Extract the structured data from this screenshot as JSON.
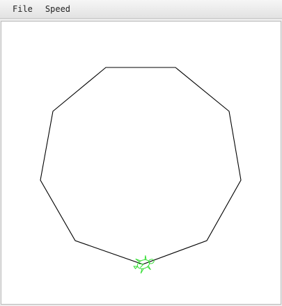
{
  "menubar": {
    "items": [
      {
        "label": "File"
      },
      {
        "label": "Speed"
      }
    ]
  },
  "drawing": {
    "shape": "nonagon",
    "stroke_color": "#000000",
    "background_color": "#ffffff",
    "turtle_color": "#33dd33"
  }
}
